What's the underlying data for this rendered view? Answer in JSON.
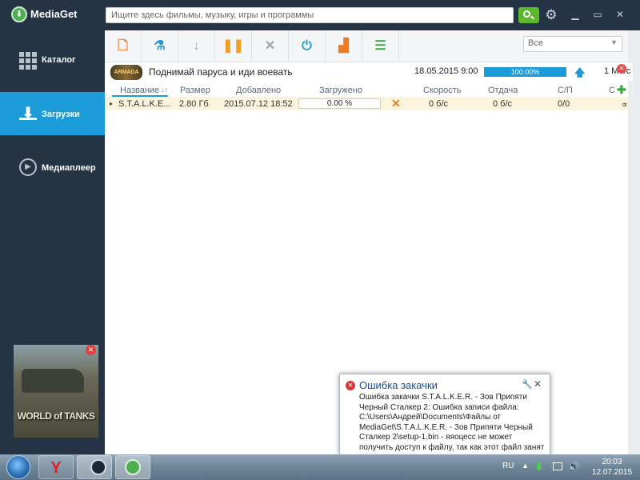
{
  "app": {
    "name": "MediaGet"
  },
  "search": {
    "placeholder": "Ищите здесь фильмы, музыку, игры и программы"
  },
  "sidebar": {
    "items": [
      {
        "label": "Каталог",
        "icon": "grid-icon"
      },
      {
        "label": "Загрузки",
        "icon": "download-icon",
        "active": true
      },
      {
        "label": "Медиаплеер",
        "icon": "play-icon"
      }
    ],
    "ad": {
      "logo_text": "WORLD of TANKS"
    }
  },
  "toolbar": {
    "buttons": [
      "add-file-icon",
      "flask-icon",
      "arrow-down-icon",
      "pause-icon",
      "close-icon",
      "power-icon",
      "chart-icon",
      "list-icon"
    ],
    "filter_value": "Все"
  },
  "promo": {
    "title": "Поднимай паруса и иди воевать",
    "date": "18.05.2015 9:00",
    "progress_text": "100.00%",
    "progress": 1.0,
    "speed": "1 Mб/с"
  },
  "table": {
    "headers": [
      "Название",
      "Размер",
      "Добавлено",
      "Загружено",
      "Скорость",
      "Отдача",
      "С/П",
      "С"
    ],
    "rows": [
      {
        "name": "S.T.A.L.K.E...",
        "size": "2.80 Гб",
        "added": "2015.07.12 18:52",
        "progress": "0.00 %",
        "speed": "0 б/с",
        "upload": "0 б/с",
        "sp": "0/0",
        "extra": "∝"
      }
    ]
  },
  "notification": {
    "title": "Ошибка закачки",
    "body": "Ошибка закачки S.T.A.L.K.E.R. - Зов Припяти Черный Сталкер 2: Ошибка записи файла: C:\\Users\\Андрей\\Documents\\Файлы от MediaGet\\S.T.A.L.K.E.R. - Зов Припяти Черный Сталкер 2\\setup-1.bin - яяоцесс не может получить доступ к файлу, так как этот файл занят др"
  },
  "taskbar": {
    "lang": "RU",
    "time": "20:03",
    "date": "12.07.2015"
  },
  "colors": {
    "accent": "#1b9bd8",
    "sidebar": "#243444",
    "search_button": "#5cb82d"
  }
}
